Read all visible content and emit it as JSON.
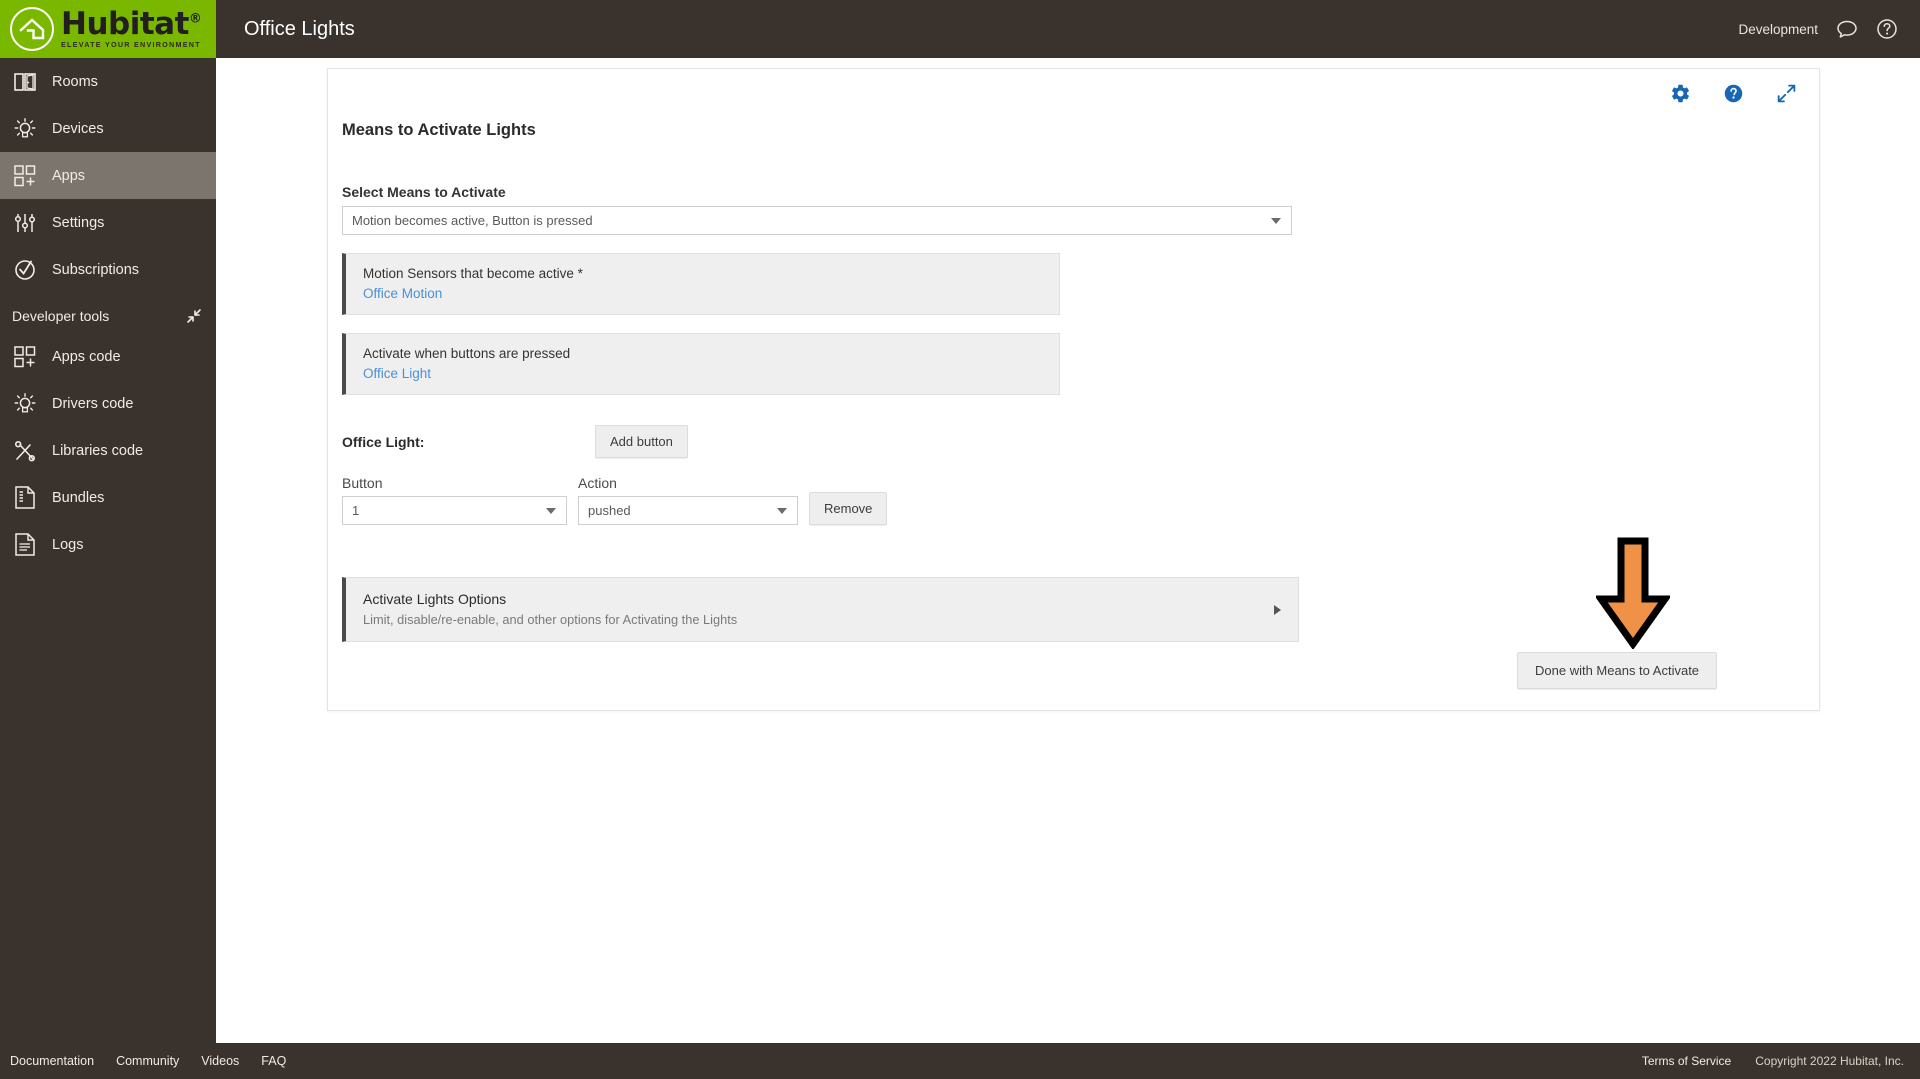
{
  "brand": {
    "name": "Hubitat",
    "tagline": "ELEVATE YOUR ENVIRONMENT"
  },
  "topbar": {
    "title": "Office Lights",
    "mode_label": "Development",
    "chat_icon": "chat-bubble-icon",
    "help_icon": "help-circle-icon"
  },
  "sidebar": {
    "items": [
      {
        "label": "Rooms",
        "icon": "rooms-icon",
        "active": false
      },
      {
        "label": "Devices",
        "icon": "device-bulb-icon",
        "active": false
      },
      {
        "label": "Apps",
        "icon": "apps-grid-icon",
        "active": true
      },
      {
        "label": "Settings",
        "icon": "sliders-icon",
        "active": false
      },
      {
        "label": "Subscriptions",
        "icon": "check-circle-icon",
        "active": false
      }
    ],
    "developer_tools": {
      "label": "Developer tools",
      "collapse_icon": "collapse-arrows-icon",
      "items": [
        {
          "label": "Apps code",
          "icon": "apps-grid-icon"
        },
        {
          "label": "Drivers code",
          "icon": "device-bulb-icon"
        },
        {
          "label": "Libraries code",
          "icon": "tools-icon"
        },
        {
          "label": "Bundles",
          "icon": "bundle-document-icon"
        },
        {
          "label": "Logs",
          "icon": "logs-document-icon"
        }
      ]
    }
  },
  "panel": {
    "icons": [
      {
        "name": "gear-icon",
        "color": "#1767b5"
      },
      {
        "name": "help-circle-icon",
        "color": "#1767b5"
      },
      {
        "name": "expand-arrows-icon",
        "color": "#1767b5"
      }
    ],
    "section_title": "Means to Activate Lights",
    "select_means": {
      "label": "Select Means to Activate",
      "value": "Motion becomes active, Button is pressed"
    },
    "device_cards": [
      {
        "title": "Motion Sensors that become active *",
        "link": "Office Motion"
      },
      {
        "title": "Activate when buttons are pressed",
        "link": "Office Light"
      }
    ],
    "button_config": {
      "device_label": "Office Light:",
      "add_button_label": "Add button",
      "button_label": "Button",
      "button_value": "1",
      "action_label": "Action",
      "action_value": "pushed",
      "remove_label": "Remove"
    },
    "options_card": {
      "title": "Activate Lights Options",
      "subtitle": "Limit, disable/re-enable, and other options for Activating the Lights",
      "caret_icon": "chevron-right-icon"
    },
    "done_button": "Done with Means to Activate",
    "annotation_arrow": {
      "name": "orange-down-arrow-annotation",
      "fill": "#ef9146",
      "stroke": "#000000"
    }
  },
  "footer": {
    "left_links": [
      "Documentation",
      "Community",
      "Videos",
      "FAQ"
    ],
    "right_links": [
      "Terms of Service"
    ],
    "copyright": "Copyright 2022 Hubitat, Inc."
  }
}
